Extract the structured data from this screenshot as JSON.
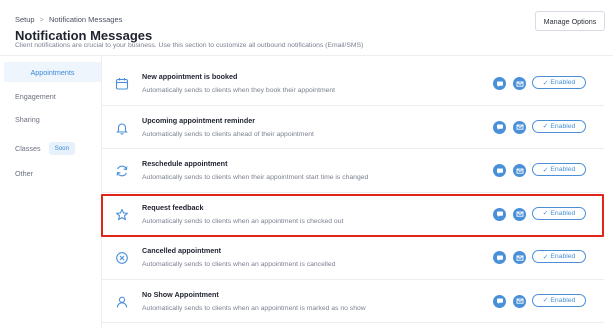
{
  "breadcrumb": {
    "root": "Setup",
    "separator": ">",
    "current": "Notification Messages"
  },
  "header": {
    "title": "Notification Messages",
    "subtitle": "Client notifications are crucial to your business. Use this section to customize all outbound notifications (Email/SMS)",
    "manage_label": "Manage Options"
  },
  "sidebar": {
    "items": [
      {
        "label": "Appointments",
        "active": true
      },
      {
        "label": "Engagement"
      },
      {
        "label": "Sharing"
      },
      {
        "label": "Classes",
        "badge": "Soon"
      },
      {
        "label": "Other"
      }
    ]
  },
  "notifications": [
    {
      "title": "New appointment is booked",
      "description": "Automatically sends to clients when they book their appointment",
      "icon": "calendar-icon",
      "status": "Enabled"
    },
    {
      "title": "Upcoming appointment reminder",
      "description": "Automatically sends to clients ahead of their appointment",
      "icon": "bell-icon",
      "status": "Enabled"
    },
    {
      "title": "Reschedule appointment",
      "description": "Automatically sends to clients when their appointment start time is changed",
      "icon": "refresh-icon",
      "status": "Enabled"
    },
    {
      "title": "Request feedback",
      "description": "Automatically sends to clients when an appointment is checked out",
      "icon": "star-icon",
      "status": "Enabled",
      "highlighted": true
    },
    {
      "title": "Cancelled appointment",
      "description": "Automatically sends to clients when an appointment is cancelled",
      "icon": "cancel-circle-icon",
      "status": "Enabled"
    },
    {
      "title": "No Show Appointment",
      "description": "Automatically sends to clients when an appointment is marked as no show",
      "icon": "user-icon",
      "status": "Enabled"
    }
  ],
  "colors": {
    "accent": "#4a90d9",
    "highlight": "#e0261b",
    "active_bg": "#eef5fc"
  }
}
